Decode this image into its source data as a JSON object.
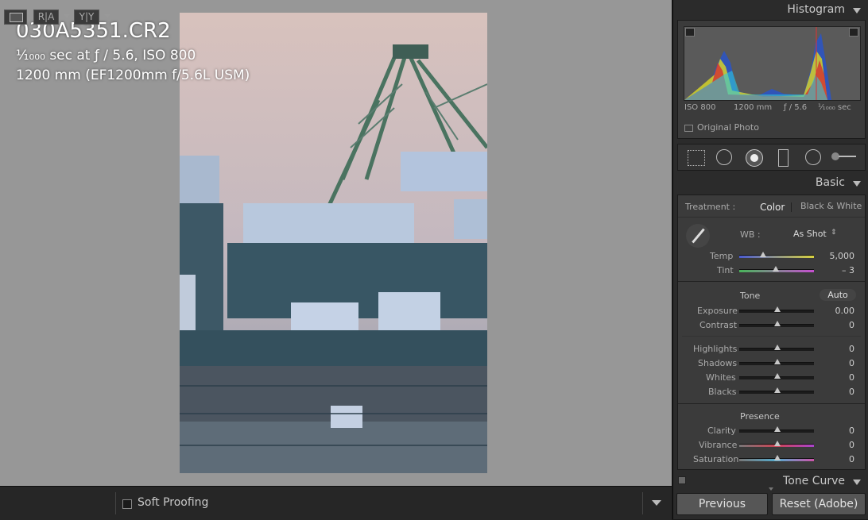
{
  "photo_info": {
    "filename": "030A5351.CR2",
    "exposure": "¹⁄₁₀₀₀ sec at ƒ / 5.6, ISO 800",
    "lens": "1200 mm (EF1200mm f/5.6L USM)"
  },
  "toolbar": {
    "soft_proofing_label": "Soft Proofing",
    "compare_label": "R|A",
    "survey_label": "Y|Y"
  },
  "histogram": {
    "title": "Histogram",
    "iso": "ISO 800",
    "focal": "1200 mm",
    "aperture": "ƒ / 5.6",
    "shutter": "¹⁄₁₀₀₀ sec",
    "original_photo_label": "Original Photo"
  },
  "tools": [
    "crop-overlay-icon",
    "spot-removal-icon",
    "red-eye-icon",
    "graduated-filter-icon",
    "radial-filter-icon",
    "adjustment-brush-icon"
  ],
  "basic": {
    "title": "Basic",
    "treatment_label": "Treatment :",
    "color_label": "Color",
    "bw_label": "Black & White",
    "wb_label": "WB :",
    "wb_value": "As Shot",
    "temp_label": "Temp",
    "temp_value": "5,000",
    "temp_level": 0.32,
    "tint_label": "Tint",
    "tint_value": "– 3",
    "tint_level": 0.49,
    "tone_label": "Tone",
    "auto_label": "Auto",
    "exposure_label": "Exposure",
    "exposure_value": "0.00",
    "contrast_label": "Contrast",
    "contrast_value": "0",
    "highlights_label": "Highlights",
    "highlights_value": "0",
    "shadows_label": "Shadows",
    "shadows_value": "0",
    "whites_label": "Whites",
    "whites_value": "0",
    "blacks_label": "Blacks",
    "blacks_value": "0",
    "presence_label": "Presence",
    "clarity_label": "Clarity",
    "clarity_value": "0",
    "vibrance_label": "Vibrance",
    "vibrance_value": "0",
    "saturation_label": "Saturation",
    "saturation_value": "0"
  },
  "tone_curve": {
    "title": "Tone Curve"
  },
  "buttons": {
    "previous": "Previous",
    "reset": "Reset (Adobe)"
  },
  "colors": {
    "temp_track": "#6a6acc",
    "tint_track": "#55aa66",
    "accent": "#c8c8c8"
  }
}
